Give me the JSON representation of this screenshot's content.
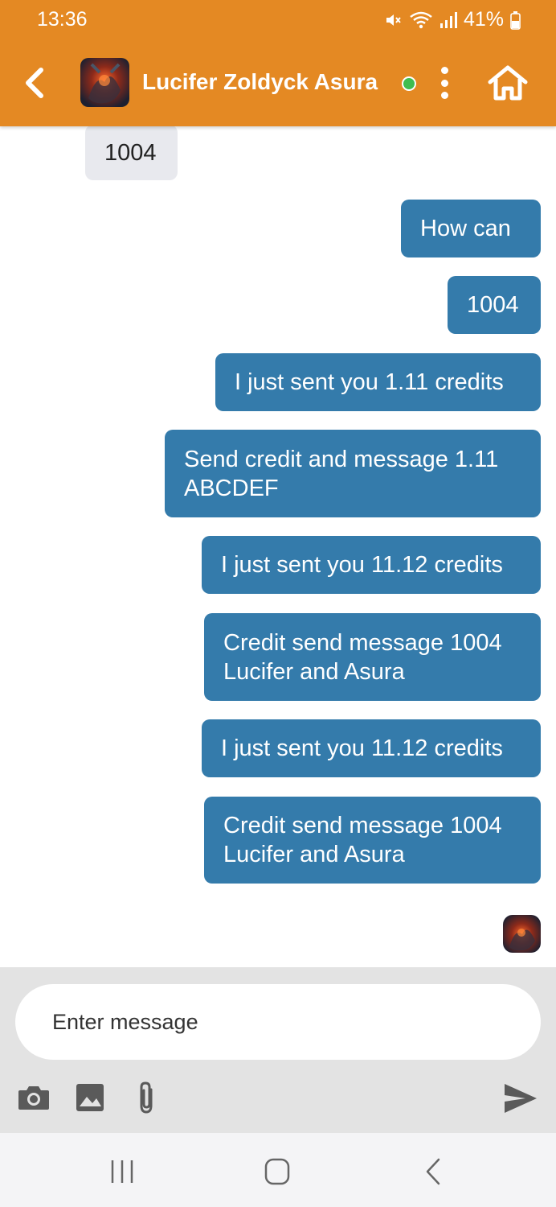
{
  "status_bar": {
    "time": "13:36",
    "battery": "41%"
  },
  "app_bar": {
    "contact_name": "Lucifer Zoldyck Asura",
    "online": true,
    "colors": {
      "header": "#e48923",
      "online_dot": "#3fbd4f"
    }
  },
  "messages": [
    {
      "direction": "in",
      "text": "1004"
    },
    {
      "direction": "out",
      "text": "How can"
    },
    {
      "direction": "out",
      "text": "1004"
    },
    {
      "direction": "out",
      "text": "I just sent you 1.11 credits"
    },
    {
      "direction": "out",
      "lines": [
        "Send credit and message 1.11",
        "ABCDEF"
      ]
    },
    {
      "direction": "out",
      "text": "I just sent you 11.12 credits"
    },
    {
      "direction": "out",
      "lines": [
        "Credit send message 1004",
        "Lucifer and Asura"
      ]
    },
    {
      "direction": "out",
      "text": "I just sent you 11.12 credits"
    },
    {
      "direction": "out",
      "lines": [
        "Credit send message 1004",
        "Lucifer and Asura"
      ]
    }
  ],
  "composer": {
    "placeholder": "Enter message",
    "tools": [
      "camera-icon",
      "image-icon",
      "attachment-icon"
    ],
    "send_icon": "send-icon"
  },
  "nav_bar": {
    "buttons": [
      "recent-apps-icon",
      "home-circle-icon",
      "back-icon"
    ]
  },
  "colors": {
    "outgoing_bubble": "#347bab",
    "incoming_bubble": "#e8e9ee"
  }
}
